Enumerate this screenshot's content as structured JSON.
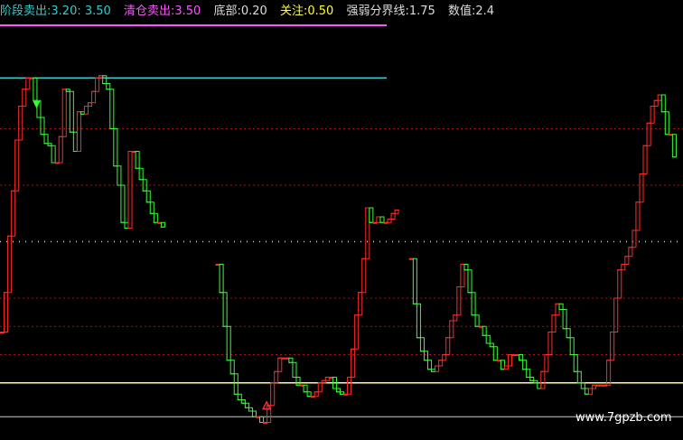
{
  "legend": {
    "items": [
      {
        "label": "阶段卖出",
        "sep": ": ",
        "value": "3.20",
        "extra": " : 3.50",
        "label_color": "#33cccc",
        "value_color": "#33cccc"
      },
      {
        "label": "清仓卖出",
        "sep": ": ",
        "value": "3.50",
        "extra": "",
        "label_color": "#ff55ff",
        "value_color": "#ff55ff"
      },
      {
        "label": "底部",
        "sep": ": ",
        "value": "0.20",
        "extra": "",
        "label_color": "#dddddd",
        "value_color": "#dddddd"
      },
      {
        "label": "关注",
        "sep": ": ",
        "value": "0.50",
        "extra": "",
        "label_color": "#ffff33",
        "value_color": "#ffff33"
      },
      {
        "label": "强弱分界线",
        "sep": ": ",
        "value": "1.75",
        "extra": "",
        "label_color": "#dddddd",
        "value_color": "#dddddd"
      },
      {
        "label": "数值",
        "sep": ": ",
        "value": "2.4",
        "extra": "",
        "label_color": "#dddddd",
        "value_color": "#dddddd"
      }
    ]
  },
  "watermark": "www.7gpzb.com",
  "colors": {
    "background": "#000000",
    "rise": "#ff2a2a",
    "fall": "#33ff33",
    "sell_stage_line": "#33cccc",
    "clear_line": "#ff55ff",
    "focus_line": "#ffff88",
    "bottom_line": "#cccccc",
    "grid_red": "#aa1111",
    "grid_white": "#cccccc",
    "watermark": "#ffffff"
  },
  "chart_data": {
    "type": "line",
    "ylim": [
      0.05,
      3.65
    ],
    "reference_lines": [
      {
        "name": "阶段卖出",
        "value": 3.2
      },
      {
        "name": "清仓卖出",
        "value": 3.5
      },
      {
        "name": "关注",
        "value": 0.5
      },
      {
        "name": "底部",
        "value": 0.2
      },
      {
        "name": "强弱分界线",
        "value": 1.75
      }
    ],
    "x": [
      0,
      1,
      2,
      3,
      4,
      5,
      6,
      7,
      8,
      9,
      10,
      11,
      12,
      13,
      14,
      15,
      16,
      17,
      18,
      19,
      20,
      21,
      22,
      23,
      24,
      25,
      26,
      27,
      28,
      29,
      30,
      31,
      32,
      33,
      34,
      35,
      36,
      37,
      38,
      39,
      40,
      41,
      42,
      43,
      44,
      45,
      46,
      47,
      48,
      49,
      50,
      51,
      52,
      53,
      54,
      55,
      56,
      57,
      58,
      59,
      60,
      61,
      62,
      63,
      64,
      65,
      66,
      67,
      68,
      69,
      70,
      71,
      72,
      73,
      74,
      75,
      76,
      77,
      78,
      79,
      80,
      81,
      82,
      83,
      84,
      85,
      86,
      87,
      88,
      89,
      90,
      91,
      92,
      93,
      94,
      95,
      96,
      97,
      98,
      99,
      100,
      101,
      102,
      103,
      104,
      105,
      106,
      107,
      108,
      109,
      110,
      111,
      112,
      113,
      114,
      115,
      116,
      117,
      118,
      119,
      120,
      121,
      122,
      123,
      124,
      125,
      126,
      127,
      128,
      129,
      130,
      131,
      132,
      133,
      134,
      135,
      136,
      137,
      138,
      139,
      140,
      141,
      142,
      143,
      144,
      145,
      146,
      147,
      148,
      149,
      150,
      151,
      152,
      153,
      154,
      155,
      156,
      157,
      158,
      159,
      160,
      161,
      162,
      163,
      164,
      165,
      166,
      167,
      168,
      169,
      170,
      171,
      172,
      173,
      174,
      175,
      176,
      177,
      178,
      179,
      180,
      181,
      182,
      183,
      184,
      185,
      186
    ],
    "series": [
      {
        "values": [
          0.95,
          1.3,
          1.8,
          2.2,
          2.65,
          2.95,
          3.1,
          3.2,
          3.2,
          3.0,
          2.85,
          2.7,
          2.62,
          2.6,
          2.45,
          2.45,
          2.68,
          3.1,
          3.08,
          2.72,
          2.55,
          2.9,
          2.88,
          2.95,
          2.98,
          3.08,
          3.2,
          3.22,
          3.15,
          3.1,
          2.75,
          2.42,
          2.25,
          1.92,
          1.87,
          2.55,
          2.55,
          2.4,
          2.3,
          2.2,
          2.1,
          2.0,
          1.92,
          1.92,
          1.88,
          null,
          null,
          null,
          null,
          null,
          null,
          null,
          null,
          null,
          null,
          null,
          null,
          null,
          null,
          1.55,
          1.3,
          1.0,
          0.7,
          0.58,
          0.4,
          0.35,
          0.32,
          0.28,
          0.25,
          0.2,
          0.2,
          0.15,
          0.15,
          0.3,
          0.5,
          0.6,
          0.72,
          0.72,
          0.72,
          0.68,
          0.55,
          0.48,
          0.48,
          0.42,
          0.38,
          0.38,
          0.42,
          0.5,
          0.52,
          0.55,
          0.55,
          0.45,
          0.42,
          0.4,
          0.4,
          0.55,
          0.8,
          1.1,
          1.3,
          1.6,
          2.05,
          1.92,
          1.92,
          1.97,
          1.92,
          1.92,
          1.95,
          2.0,
          2.03,
          null,
          null,
          null,
          1.6,
          1.2,
          0.9,
          0.78,
          0.7,
          0.62,
          0.6,
          0.65,
          0.7,
          0.75,
          0.9,
          1.05,
          1.1,
          1.35,
          1.55,
          1.5,
          1.3,
          1.1,
          1.0,
          1.0,
          0.92,
          0.85,
          0.82,
          0.7,
          0.7,
          0.62,
          0.65,
          0.75,
          0.75,
          0.75,
          0.7,
          0.62,
          0.55,
          0.52,
          0.5,
          0.45,
          0.6,
          0.75,
          0.95,
          1.1,
          1.2,
          1.15,
          0.98,
          0.9,
          0.75,
          0.6,
          0.5,
          0.45,
          0.4,
          0.45,
          0.48,
          0.48,
          0.48,
          0.48,
          0.7,
          0.95,
          1.25,
          1.5,
          1.55,
          1.62,
          1.7,
          1.85,
          2.1,
          2.35,
          2.6,
          2.8,
          2.95,
          3.0,
          3.05,
          2.9,
          2.7,
          2.7,
          2.5
        ]
      }
    ]
  }
}
